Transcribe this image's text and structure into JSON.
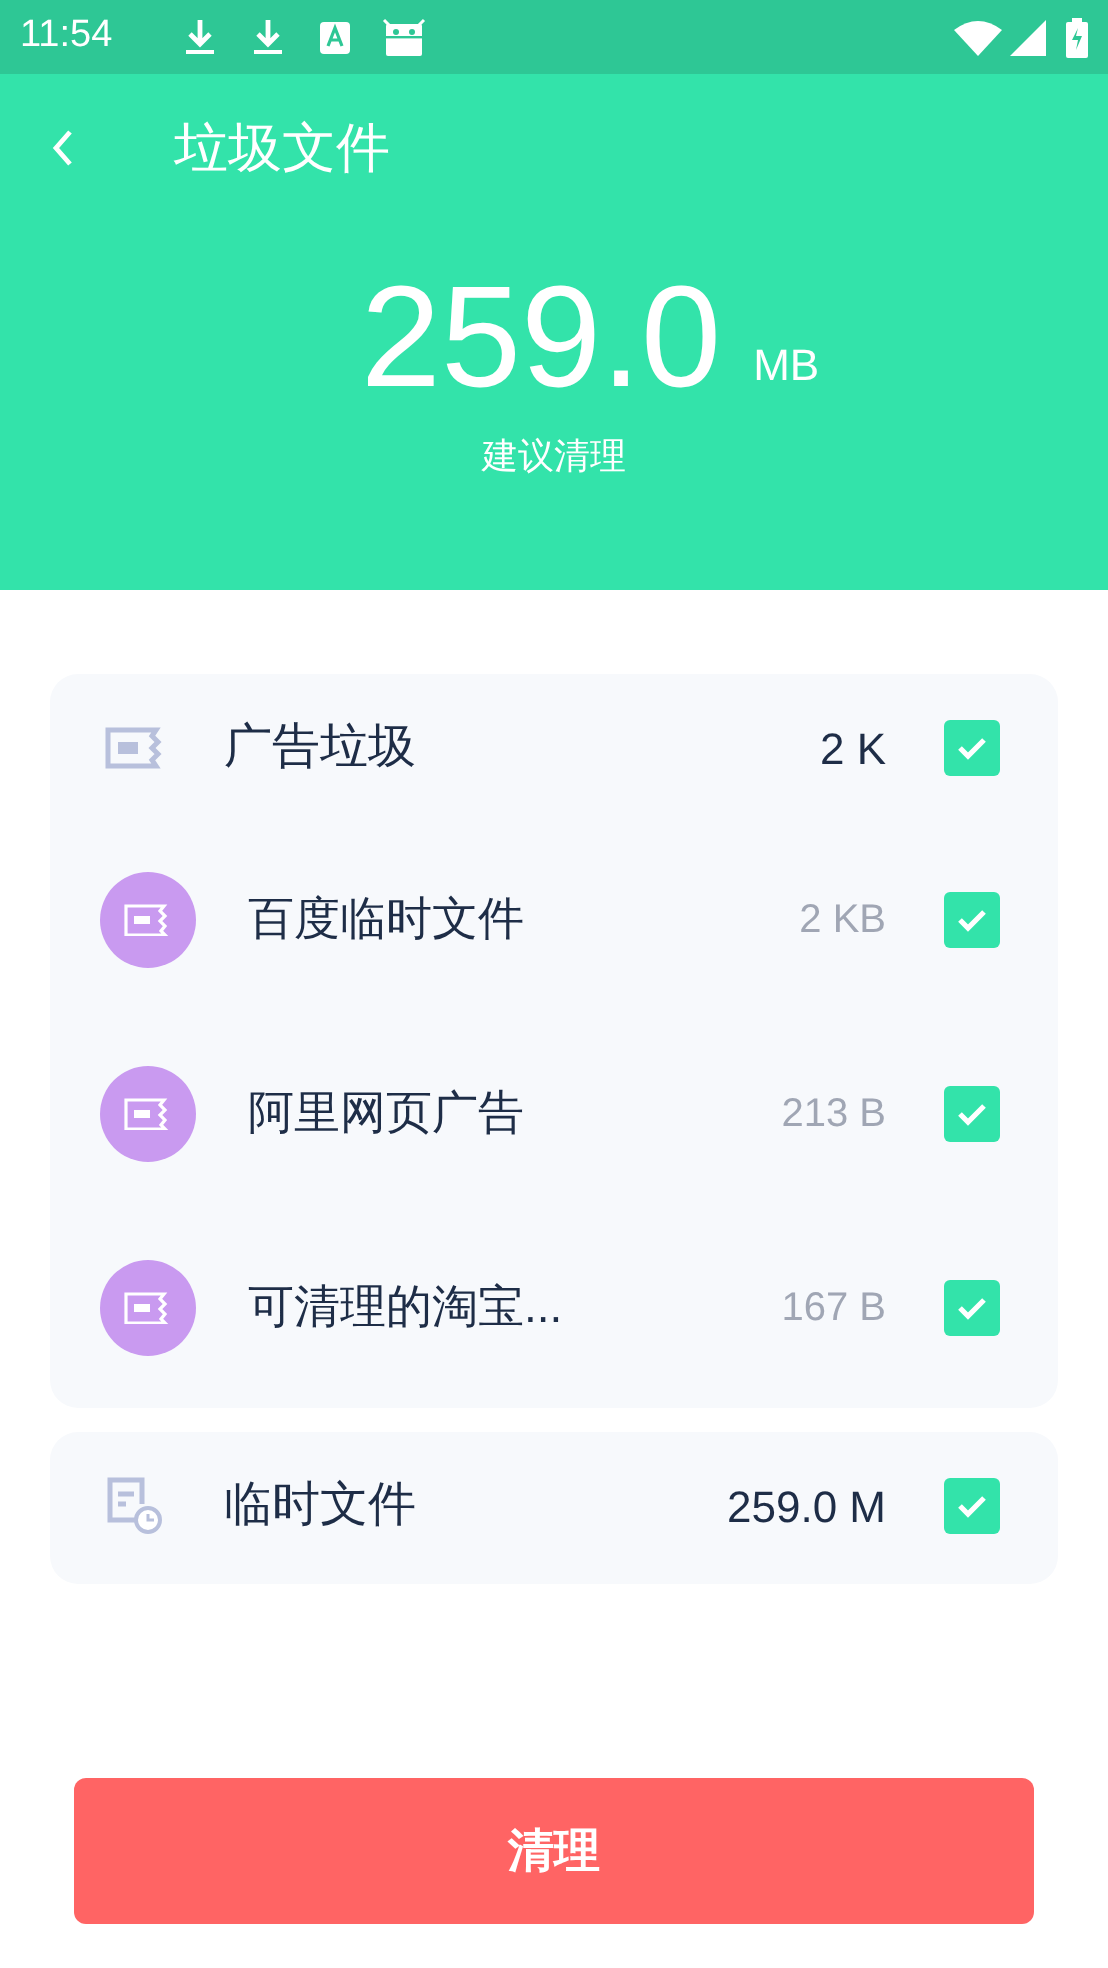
{
  "status_bar": {
    "time": "11:54"
  },
  "header": {
    "title": "垃圾文件",
    "amount": "259.0",
    "unit": "MB",
    "hint": "建议清理"
  },
  "groups": [
    {
      "kind": "ad",
      "label": "广告垃圾",
      "size": "2 K",
      "checked": true,
      "children": [
        {
          "label": "百度临时文件",
          "size": "2 KB",
          "checked": true
        },
        {
          "label": "阿里网页广告",
          "size": "213 B",
          "checked": true
        },
        {
          "label": "可清理的淘宝...",
          "size": "167 B",
          "checked": true
        }
      ]
    },
    {
      "kind": "temp",
      "label": "临时文件",
      "size": "259.0 M",
      "checked": true
    }
  ],
  "clean_button": "清理"
}
